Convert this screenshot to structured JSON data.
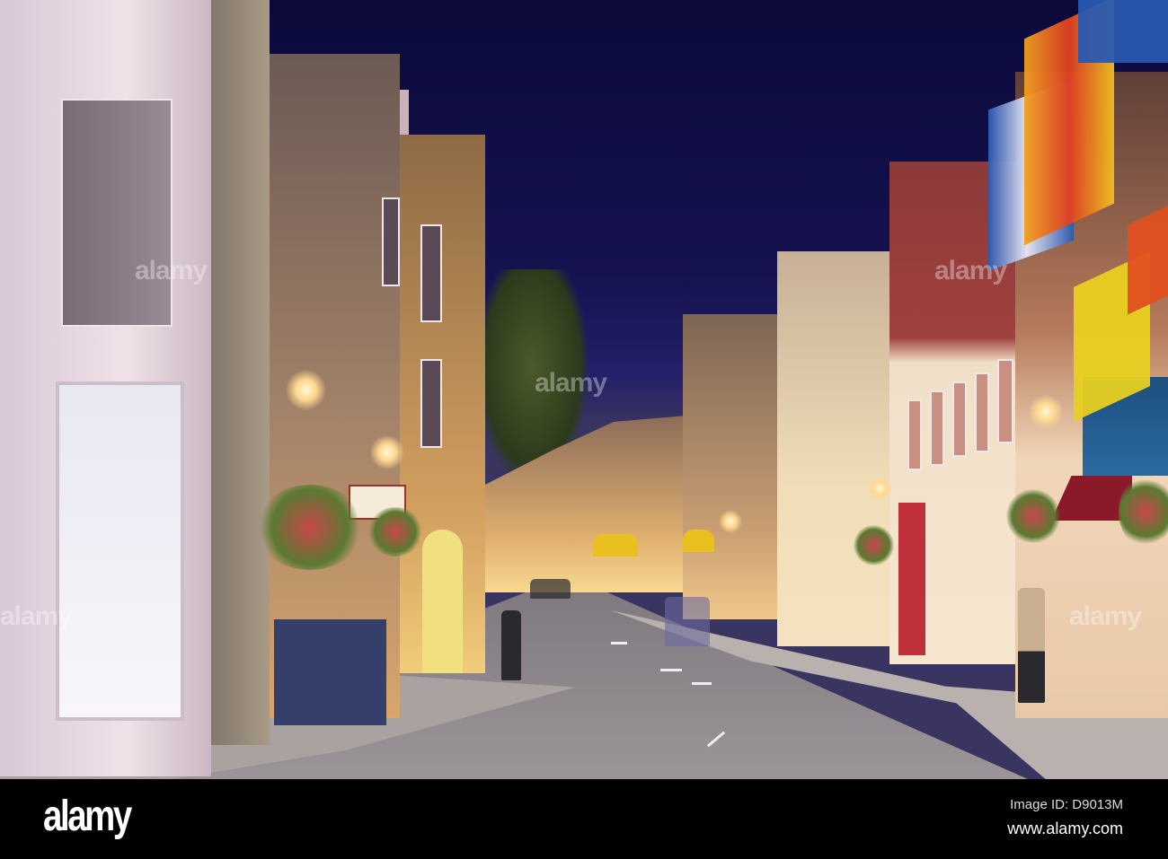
{
  "watermark": {
    "logo_text": "alamy"
  },
  "footer": {
    "logo": "alamy",
    "image_id": "Image ID: D9013M",
    "website": "www.alamy.com"
  },
  "colors": {
    "sky": "#0b0a3a",
    "footer_bg": "#000000"
  }
}
